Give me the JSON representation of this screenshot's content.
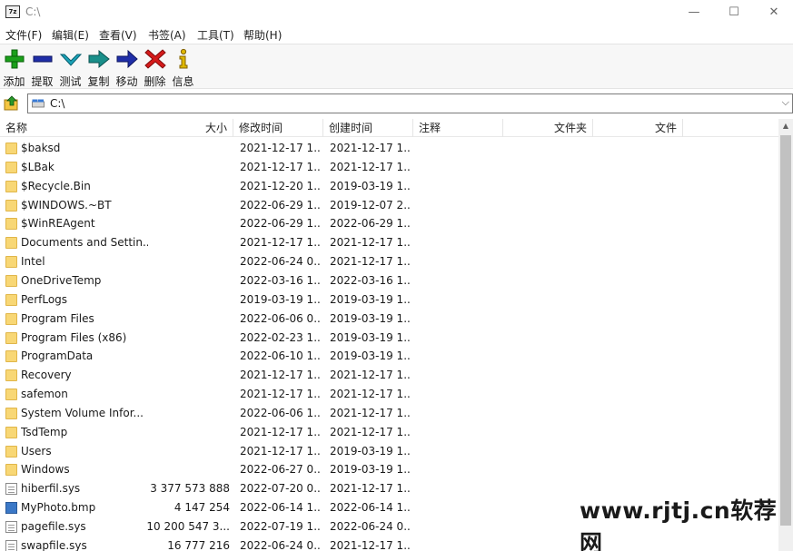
{
  "window": {
    "title": "C:\\",
    "app_icon_text": "7z",
    "minimize": "—",
    "maximize": "☐",
    "close": "✕"
  },
  "menu": [
    {
      "label": "文件(F)"
    },
    {
      "label": "编辑(E)"
    },
    {
      "label": "查看(V)"
    },
    {
      "label": "书签(A)"
    },
    {
      "label": "工具(T)"
    },
    {
      "label": "帮助(H)"
    }
  ],
  "toolbar": [
    {
      "label": "添加",
      "icon": "plus-icon",
      "color": "#1aa01a"
    },
    {
      "label": "提取",
      "icon": "minus-icon",
      "color": "#1f2ea8"
    },
    {
      "label": "测试",
      "icon": "check-icon",
      "color": "#1aa3b8"
    },
    {
      "label": "复制",
      "icon": "copy-arrow-icon",
      "color": "#1a8f8a"
    },
    {
      "label": "移动",
      "icon": "move-arrow-icon",
      "color": "#1f2ea8"
    },
    {
      "label": "删除",
      "icon": "delete-x-icon",
      "color": "#d41a1a"
    },
    {
      "label": "信息",
      "icon": "info-icon",
      "color": "#c8a200"
    }
  ],
  "address": {
    "value": "C:\\"
  },
  "columns": [
    {
      "label": "名称"
    },
    {
      "label": "大小"
    },
    {
      "label": "修改时间"
    },
    {
      "label": "创建时间"
    },
    {
      "label": "注释"
    },
    {
      "label": "文件夹"
    },
    {
      "label": "文件"
    }
  ],
  "rows": [
    {
      "type": "folder",
      "name": "$baksd",
      "size": "",
      "modified": "2021-12-17 1...",
      "created": "2021-12-17 1..."
    },
    {
      "type": "folder",
      "name": "$LBak",
      "size": "",
      "modified": "2021-12-17 1...",
      "created": "2021-12-17 1..."
    },
    {
      "type": "folder",
      "name": "$Recycle.Bin",
      "size": "",
      "modified": "2021-12-20 1...",
      "created": "2019-03-19 1..."
    },
    {
      "type": "folder",
      "name": "$WINDOWS.~BT",
      "size": "",
      "modified": "2022-06-29 1...",
      "created": "2019-12-07 2..."
    },
    {
      "type": "folder",
      "name": "$WinREAgent",
      "size": "",
      "modified": "2022-06-29 1...",
      "created": "2022-06-29 1..."
    },
    {
      "type": "folder",
      "name": "Documents and Settin...",
      "size": "",
      "modified": "2021-12-17 1...",
      "created": "2021-12-17 1..."
    },
    {
      "type": "folder",
      "name": "Intel",
      "size": "",
      "modified": "2022-06-24 0...",
      "created": "2021-12-17 1..."
    },
    {
      "type": "folder",
      "name": "OneDriveTemp",
      "size": "",
      "modified": "2022-03-16 1...",
      "created": "2022-03-16 1..."
    },
    {
      "type": "folder",
      "name": "PerfLogs",
      "size": "",
      "modified": "2019-03-19 1...",
      "created": "2019-03-19 1..."
    },
    {
      "type": "folder",
      "name": "Program Files",
      "size": "",
      "modified": "2022-06-06 0...",
      "created": "2019-03-19 1..."
    },
    {
      "type": "folder",
      "name": "Program Files (x86)",
      "size": "",
      "modified": "2022-02-23 1...",
      "created": "2019-03-19 1..."
    },
    {
      "type": "folder",
      "name": "ProgramData",
      "size": "",
      "modified": "2022-06-10 1...",
      "created": "2019-03-19 1..."
    },
    {
      "type": "folder",
      "name": "Recovery",
      "size": "",
      "modified": "2021-12-17 1...",
      "created": "2021-12-17 1..."
    },
    {
      "type": "folder",
      "name": "safemon",
      "size": "",
      "modified": "2021-12-17 1...",
      "created": "2021-12-17 1..."
    },
    {
      "type": "folder",
      "name": "System Volume Infor...",
      "size": "",
      "modified": "2022-06-06 1...",
      "created": "2021-12-17 1..."
    },
    {
      "type": "folder",
      "name": "TsdTemp",
      "size": "",
      "modified": "2021-12-17 1...",
      "created": "2021-12-17 1..."
    },
    {
      "type": "folder",
      "name": "Users",
      "size": "",
      "modified": "2021-12-17 1...",
      "created": "2019-03-19 1..."
    },
    {
      "type": "folder",
      "name": "Windows",
      "size": "",
      "modified": "2022-06-27 0...",
      "created": "2019-03-19 1..."
    },
    {
      "type": "file",
      "name": "hiberfil.sys",
      "size": "3 377 573 888",
      "modified": "2022-07-20 0...",
      "created": "2021-12-17 1..."
    },
    {
      "type": "bmp",
      "name": "MyPhoto.bmp",
      "size": "4 147 254",
      "modified": "2022-06-14 1...",
      "created": "2022-06-14 1..."
    },
    {
      "type": "file",
      "name": "pagefile.sys",
      "size": "10 200 547 3...",
      "modified": "2022-07-19 1...",
      "created": "2022-06-24 0..."
    },
    {
      "type": "file",
      "name": "swapfile.sys",
      "size": "16 777 216",
      "modified": "2022-06-24 0...",
      "created": "2021-12-17 1..."
    }
  ],
  "watermark": "www.rjtj.cn软荐网"
}
